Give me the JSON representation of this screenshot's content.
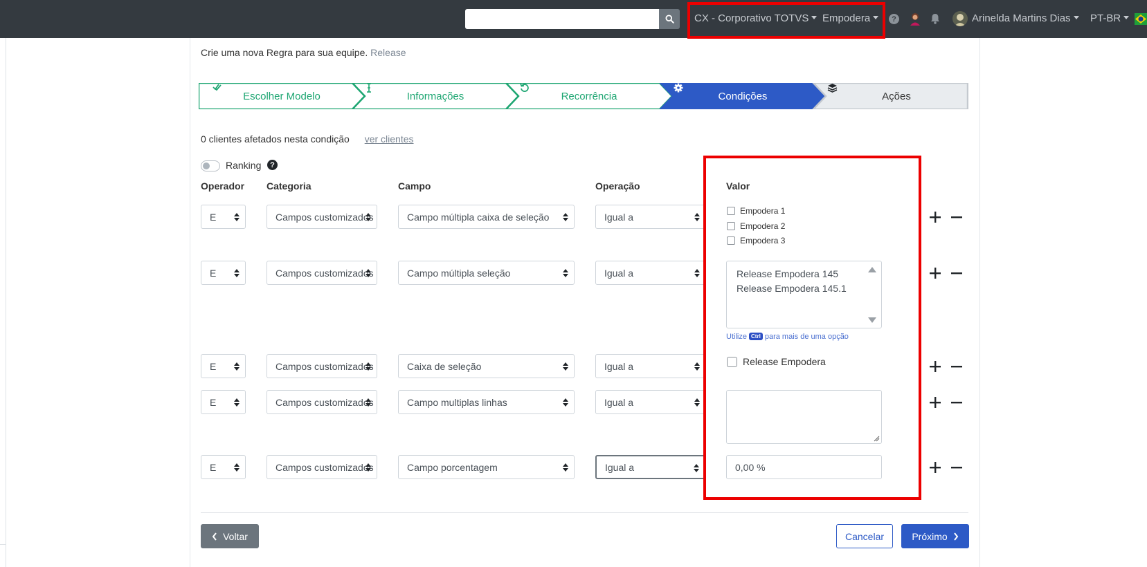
{
  "header": {
    "search_value": "",
    "org_menu": "CX - Corporativo TOTVS",
    "workspace_menu": "Empodera",
    "user_name": "Arinelda Martins Dias",
    "language": "PT-BR"
  },
  "intro": {
    "text": "Crie uma nova Regra para sua equipe.",
    "name": "Release"
  },
  "wizard": {
    "steps": [
      "Escolher Modelo",
      "Informações",
      "Recorrência",
      "Condições",
      "Ações"
    ],
    "colors": {
      "done": "#1ea672",
      "active": "#2d5ac6",
      "pending": "#e9ecef"
    }
  },
  "info": {
    "affected": "0 clientes afetados nesta condição",
    "link": "ver clientes"
  },
  "ranking_label": "Ranking",
  "help_glyph": "?",
  "columns": {
    "operador": "Operador",
    "categoria": "Categoria",
    "campo": "Campo",
    "operacao": "Operação",
    "valor": "Valor"
  },
  "rows": [
    {
      "operador": "E",
      "categoria": "Campos customizados",
      "campo": "Campo múltipla caixa de seleção",
      "operacao": "Igual a"
    },
    {
      "operador": "E",
      "categoria": "Campos customizados",
      "campo": "Campo múltipla seleção",
      "operacao": "Igual a"
    },
    {
      "operador": "E",
      "categoria": "Campos customizados",
      "campo": "Caixa de seleção",
      "operacao": "Igual a"
    },
    {
      "operador": "E",
      "categoria": "Campos customizados",
      "campo": "Campo multiplas linhas",
      "operacao": "Igual a"
    },
    {
      "operador": "E",
      "categoria": "Campos customizados",
      "campo": "Campo porcentagem",
      "operacao": "Igual a"
    }
  ],
  "values": {
    "checkboxes": [
      "Empodera 1",
      "Empodera 2",
      "Empodera 3"
    ],
    "multi_options": [
      "Release Empodera 145",
      "Release Empodera 145.1"
    ],
    "hint_prefix": "Utilize",
    "hint_key": "Ctrl",
    "hint_suffix": "para mais de uma opção",
    "single_checkbox": "Release Empodera",
    "textarea_value": "",
    "percent_value": "0,00 %"
  },
  "buttons": {
    "back": "Voltar",
    "cancel": "Cancelar",
    "next": "Próximo"
  }
}
